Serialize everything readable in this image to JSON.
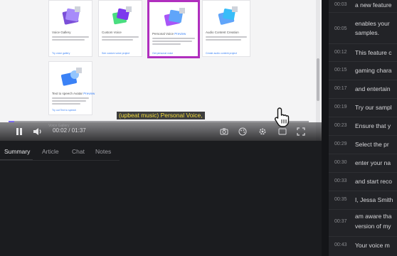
{
  "player": {
    "caption": "(upbeat music) Personal Voice,",
    "current_time": "00:02",
    "duration": "01:37",
    "chapter_label": "Voice Gallery",
    "progress_fraction": 0.02,
    "progress_color": "#7c6df0",
    "caption_color": "#f2dc3c"
  },
  "cards": [
    {
      "title": "Voice Gallery",
      "link": "Try voice gallery"
    },
    {
      "title": "Custom Voice",
      "link": "See custom voice project"
    },
    {
      "title": "Personal Voice",
      "badge": "Preview",
      "link": "Get personal voice",
      "highlight_color": "#b02fbe"
    },
    {
      "title": "Audio Content Creation",
      "link": "Create audio content project"
    },
    {
      "title": "Text to speech Avatar",
      "badge": "Preview",
      "link": "Try out Text to speech"
    }
  ],
  "tabs": [
    {
      "label": "Summary",
      "active": true
    },
    {
      "label": "Article",
      "active": false
    },
    {
      "label": "Chat",
      "active": false
    },
    {
      "label": "Notes",
      "active": false
    }
  ],
  "transcript": [
    {
      "time": "00:03",
      "text": "a new feature"
    },
    {
      "time": "00:05",
      "text": "enables your",
      "text_2": "samples."
    },
    {
      "time": "00:12",
      "text": "This feature c"
    },
    {
      "time": "00:15",
      "text": "gaming chara"
    },
    {
      "time": "00:17",
      "text": "and entertain"
    },
    {
      "time": "00:19",
      "text": "Try our sampl"
    },
    {
      "time": "00:23",
      "text": "Ensure that y"
    },
    {
      "time": "00:29",
      "text": "Select the pr"
    },
    {
      "time": "00:30",
      "text": "enter your na"
    },
    {
      "time": "00:33",
      "text": "and start reco"
    },
    {
      "time": "00:35",
      "text": "I, Jessa Smith"
    },
    {
      "time": "00:37",
      "text": "am aware tha",
      "text_2": "version of my"
    },
    {
      "time": "00:43",
      "text": "Your voice m"
    }
  ]
}
